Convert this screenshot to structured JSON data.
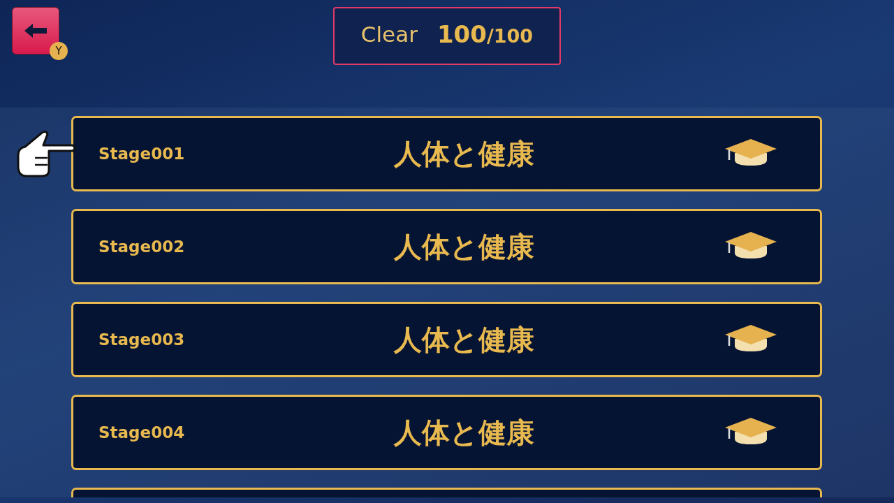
{
  "back_button": {
    "key_hint": "Y"
  },
  "clear_counter": {
    "label": "Clear",
    "count": "100",
    "total": "/100"
  },
  "stages": [
    {
      "label": "Stage001",
      "title": "人体と健康",
      "selected": true
    },
    {
      "label": "Stage002",
      "title": "人体と健康",
      "selected": false
    },
    {
      "label": "Stage003",
      "title": "人体と健康",
      "selected": false
    },
    {
      "label": "Stage004",
      "title": "人体と健康",
      "selected": false
    }
  ]
}
